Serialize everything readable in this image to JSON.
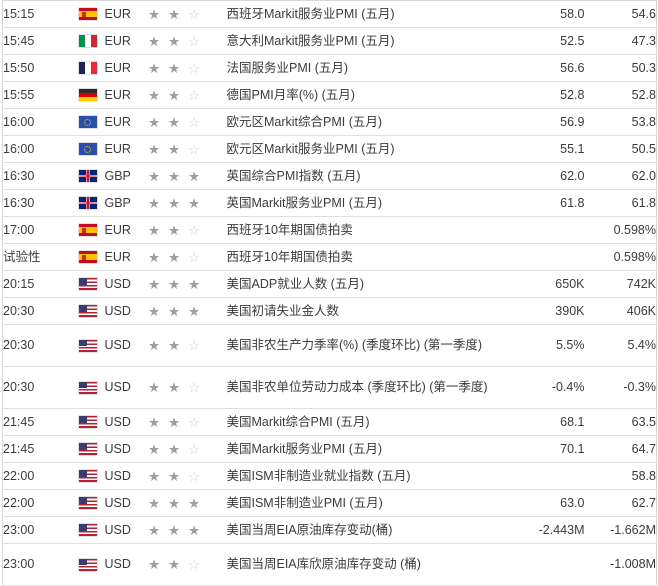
{
  "table": {
    "columns": [
      "time",
      "flag",
      "currency",
      "importance",
      "event",
      "forecast",
      "actual"
    ],
    "colors": {
      "row_border": "#e0e0e0",
      "table_border": "#d8d8d8",
      "text": "#3b3b3b",
      "forecast_text": "#8c8c8c",
      "actual_text": "#2e2e2e",
      "star_full": "#9e9e9e",
      "star_empty": "#d3d3d3"
    },
    "rows": [
      {
        "time": "15:15",
        "flag": "flag-spain-icon",
        "flag_code": "ES",
        "currency": "EUR",
        "importance": 2,
        "importance_max": 3,
        "event": "西班牙Markit服务业PMI (五月)",
        "forecast": "58.0",
        "actual": "54.6",
        "lines": 1
      },
      {
        "time": "15:45",
        "flag": "flag-italy-icon",
        "flag_code": "IT",
        "currency": "EUR",
        "importance": 2,
        "importance_max": 3,
        "event": "意大利Markit服务业PMI (五月)",
        "forecast": "52.5",
        "actual": "47.3",
        "lines": 1
      },
      {
        "time": "15:50",
        "flag": "flag-france-icon",
        "flag_code": "FR",
        "currency": "EUR",
        "importance": 2,
        "importance_max": 3,
        "event": "法国服务业PMI (五月)",
        "forecast": "56.6",
        "actual": "50.3",
        "lines": 1
      },
      {
        "time": "15:55",
        "flag": "flag-germany-icon",
        "flag_code": "DE",
        "currency": "EUR",
        "importance": 2,
        "importance_max": 3,
        "event": "德国PMI月率(%) (五月)",
        "forecast": "52.8",
        "actual": "52.8",
        "lines": 1
      },
      {
        "time": "16:00",
        "flag": "flag-eu-icon",
        "flag_code": "EU",
        "currency": "EUR",
        "importance": 2,
        "importance_max": 3,
        "event": "欧元区Markit综合PMI (五月)",
        "forecast": "56.9",
        "actual": "53.8",
        "lines": 1
      },
      {
        "time": "16:00",
        "flag": "flag-eu-icon",
        "flag_code": "EU",
        "currency": "EUR",
        "importance": 2,
        "importance_max": 3,
        "event": "欧元区Markit服务业PMI (五月)",
        "forecast": "55.1",
        "actual": "50.5",
        "lines": 1
      },
      {
        "time": "16:30",
        "flag": "flag-uk-icon",
        "flag_code": "GB",
        "currency": "GBP",
        "importance": 3,
        "importance_max": 3,
        "event": "英国综合PMI指数 (五月)",
        "forecast": "62.0",
        "actual": "62.0",
        "lines": 1
      },
      {
        "time": "16:30",
        "flag": "flag-uk-icon",
        "flag_code": "GB",
        "currency": "GBP",
        "importance": 3,
        "importance_max": 3,
        "event": "英国Markit服务业PMI (五月)",
        "forecast": "61.8",
        "actual": "61.8",
        "lines": 1
      },
      {
        "time": "17:00",
        "flag": "flag-spain-icon",
        "flag_code": "ES",
        "currency": "EUR",
        "importance": 2,
        "importance_max": 3,
        "event": "西班牙10年期国债拍卖",
        "forecast": "",
        "actual": "0.598%",
        "lines": 1
      },
      {
        "time": "试验性",
        "flag": "flag-spain-icon",
        "flag_code": "ES",
        "currency": "EUR",
        "importance": 2,
        "importance_max": 3,
        "event": "西班牙10年期国债拍卖",
        "forecast": "",
        "actual": "0.598%",
        "lines": 1
      },
      {
        "time": "20:15",
        "flag": "flag-usa-icon",
        "flag_code": "US",
        "currency": "USD",
        "importance": 3,
        "importance_max": 3,
        "event": "美国ADP就业人数 (五月)",
        "forecast": "650K",
        "actual": "742K",
        "lines": 1
      },
      {
        "time": "20:30",
        "flag": "flag-usa-icon",
        "flag_code": "US",
        "currency": "USD",
        "importance": 3,
        "importance_max": 3,
        "event": "美国初请失业金人数",
        "forecast": "390K",
        "actual": "406K",
        "lines": 1
      },
      {
        "time": "20:30",
        "flag": "flag-usa-icon",
        "flag_code": "US",
        "currency": "USD",
        "importance": 2,
        "importance_max": 3,
        "event": "美国非农生产力季率(%) (季度环比) (第一季度)",
        "forecast": "5.5%",
        "actual": "5.4%",
        "lines": 2
      },
      {
        "time": "20:30",
        "flag": "flag-usa-icon",
        "flag_code": "US",
        "currency": "USD",
        "importance": 2,
        "importance_max": 3,
        "event": "美国非农单位劳动力成本 (季度环比) (第一季度)",
        "forecast": "-0.4%",
        "actual": "-0.3%",
        "lines": 2
      },
      {
        "time": "21:45",
        "flag": "flag-usa-icon",
        "flag_code": "US",
        "currency": "USD",
        "importance": 2,
        "importance_max": 3,
        "event": "美国Markit综合PMI (五月)",
        "forecast": "68.1",
        "actual": "63.5",
        "lines": 1
      },
      {
        "time": "21:45",
        "flag": "flag-usa-icon",
        "flag_code": "US",
        "currency": "USD",
        "importance": 2,
        "importance_max": 3,
        "event": "美国Markit服务业PMI (五月)",
        "forecast": "70.1",
        "actual": "64.7",
        "lines": 1
      },
      {
        "time": "22:00",
        "flag": "flag-usa-icon",
        "flag_code": "US",
        "currency": "USD",
        "importance": 2,
        "importance_max": 3,
        "event": "美国ISM非制造业就业指数 (五月)",
        "forecast": "",
        "actual": "58.8",
        "lines": 1
      },
      {
        "time": "22:00",
        "flag": "flag-usa-icon",
        "flag_code": "US",
        "currency": "USD",
        "importance": 3,
        "importance_max": 3,
        "event": "美国ISM非制造业PMI (五月)",
        "forecast": "63.0",
        "actual": "62.7",
        "lines": 1
      },
      {
        "time": "23:00",
        "flag": "flag-usa-icon",
        "flag_code": "US",
        "currency": "USD",
        "importance": 3,
        "importance_max": 3,
        "event": "美国当周EIA原油库存变动(桶)",
        "forecast": "-2.443M",
        "actual": "-1.662M",
        "lines": 1
      },
      {
        "time": "23:00",
        "flag": "flag-usa-icon",
        "flag_code": "US",
        "currency": "USD",
        "importance": 2,
        "importance_max": 3,
        "event": "美国当周EIA库欣原油库存变动 (桶)",
        "forecast": "",
        "actual": "-1.008M",
        "lines": 2
      }
    ]
  },
  "icons": {
    "star_full": "★",
    "star_empty": "☆"
  }
}
